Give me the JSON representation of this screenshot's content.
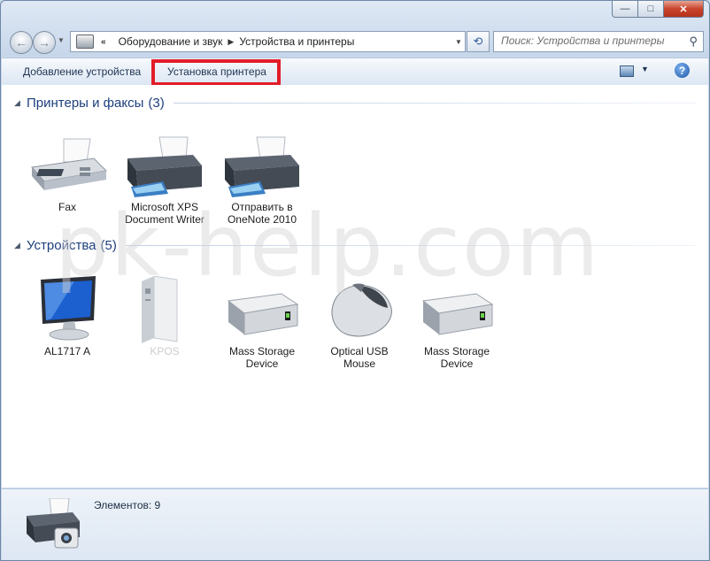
{
  "window": {
    "minimize_glyph": "—",
    "maximize_glyph": "□",
    "close_glyph": "✕"
  },
  "nav": {
    "back_glyph": "←",
    "forward_glyph": "→",
    "overflow_glyph": "«",
    "breadcrumb": [
      "Оборудование и звук",
      "Устройства и принтеры"
    ],
    "search_placeholder": "Поиск: Устройства и принтеры"
  },
  "toolbar": {
    "add_device": "Добавление устройства",
    "install_printer": "Установка принтера",
    "help_glyph": "?"
  },
  "groups": [
    {
      "title": "Принтеры и факсы",
      "count": "(3)",
      "items": [
        {
          "label": "Fax",
          "icon": "fax-icon"
        },
        {
          "label": "Microsoft XPS\nDocument Writer",
          "icon": "printer-icon"
        },
        {
          "label": "Отправить в\nOneNote 2010",
          "icon": "printer-icon"
        }
      ]
    },
    {
      "title": "Устройства",
      "count": "(5)",
      "items": [
        {
          "label": "AL1717 A",
          "icon": "monitor-icon"
        },
        {
          "label": "KPOS",
          "icon": "computer-tower-icon"
        },
        {
          "label": "Mass Storage\nDevice",
          "icon": "hard-drive-icon"
        },
        {
          "label": "Optical USB\nMouse",
          "icon": "mouse-icon"
        },
        {
          "label": "Mass Storage\nDevice",
          "icon": "hard-drive-icon"
        }
      ]
    }
  ],
  "watermark": "pk-help.com",
  "details": {
    "count_text": "Элементов: 9"
  }
}
